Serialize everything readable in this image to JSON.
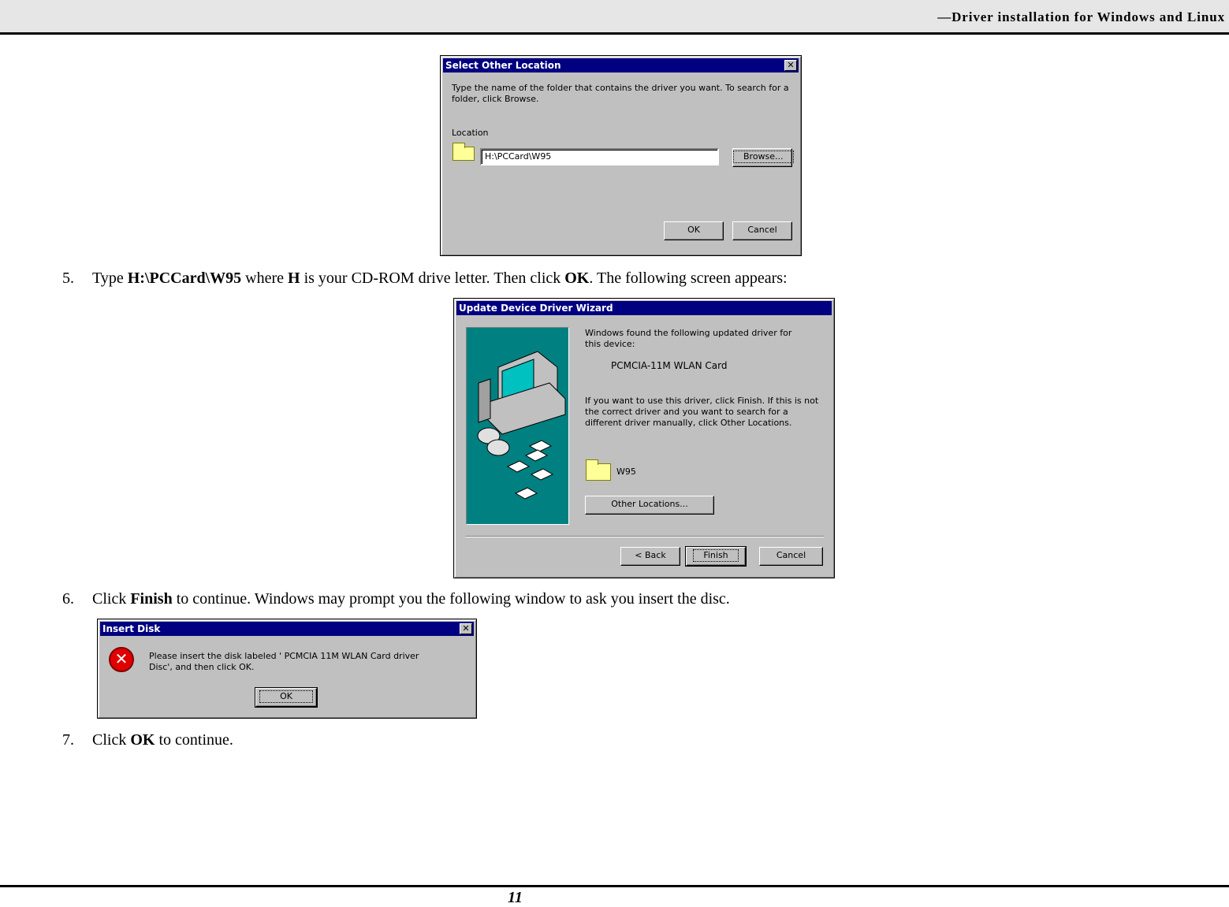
{
  "header": {
    "title": "—Driver installation for Windows and Linux"
  },
  "steps": {
    "s5": {
      "num": "5.",
      "pre": "Type ",
      "b1": "H:\\PCCard\\W95",
      "mid1": " where ",
      "b2": "H",
      "mid2": " is your CD-ROM drive letter. Then click ",
      "b3": "OK",
      "post": ". The following screen appears:"
    },
    "s6": {
      "num": "6.",
      "pre": "Click ",
      "b1": "Finish",
      "post": " to continue. Windows may prompt you the following window to ask you insert the disc."
    },
    "s7": {
      "num": "7.",
      "pre": "Click ",
      "b1": "OK",
      "post": " to continue."
    }
  },
  "dialog1": {
    "title": "Select Other Location",
    "instructions": "Type the name of the folder that contains the driver you want. To search for a folder, click Browse.",
    "location_label": "Location",
    "location_value": "H:\\PCCard\\W95",
    "browse": "Browse...",
    "ok": "OK",
    "cancel": "Cancel"
  },
  "dialog2": {
    "title": "Update Device Driver Wizard",
    "found": "Windows found the following updated driver for this device:",
    "device": "PCMCIA-11M WLAN Card",
    "info": "If you want to use this driver, click Finish. If this is not the correct driver and you want to search for a different driver manually, click Other Locations.",
    "folder": "W95",
    "other": "Other Locations...",
    "back": "< Back",
    "finish": "Finish",
    "cancel": "Cancel"
  },
  "dialog3": {
    "title": "Insert Disk",
    "message": "Please insert the disk labeled ' PCMCIA 11M WLAN Card driver Disc', and then click OK.",
    "ok": "OK"
  },
  "footer": {
    "page": "11"
  }
}
